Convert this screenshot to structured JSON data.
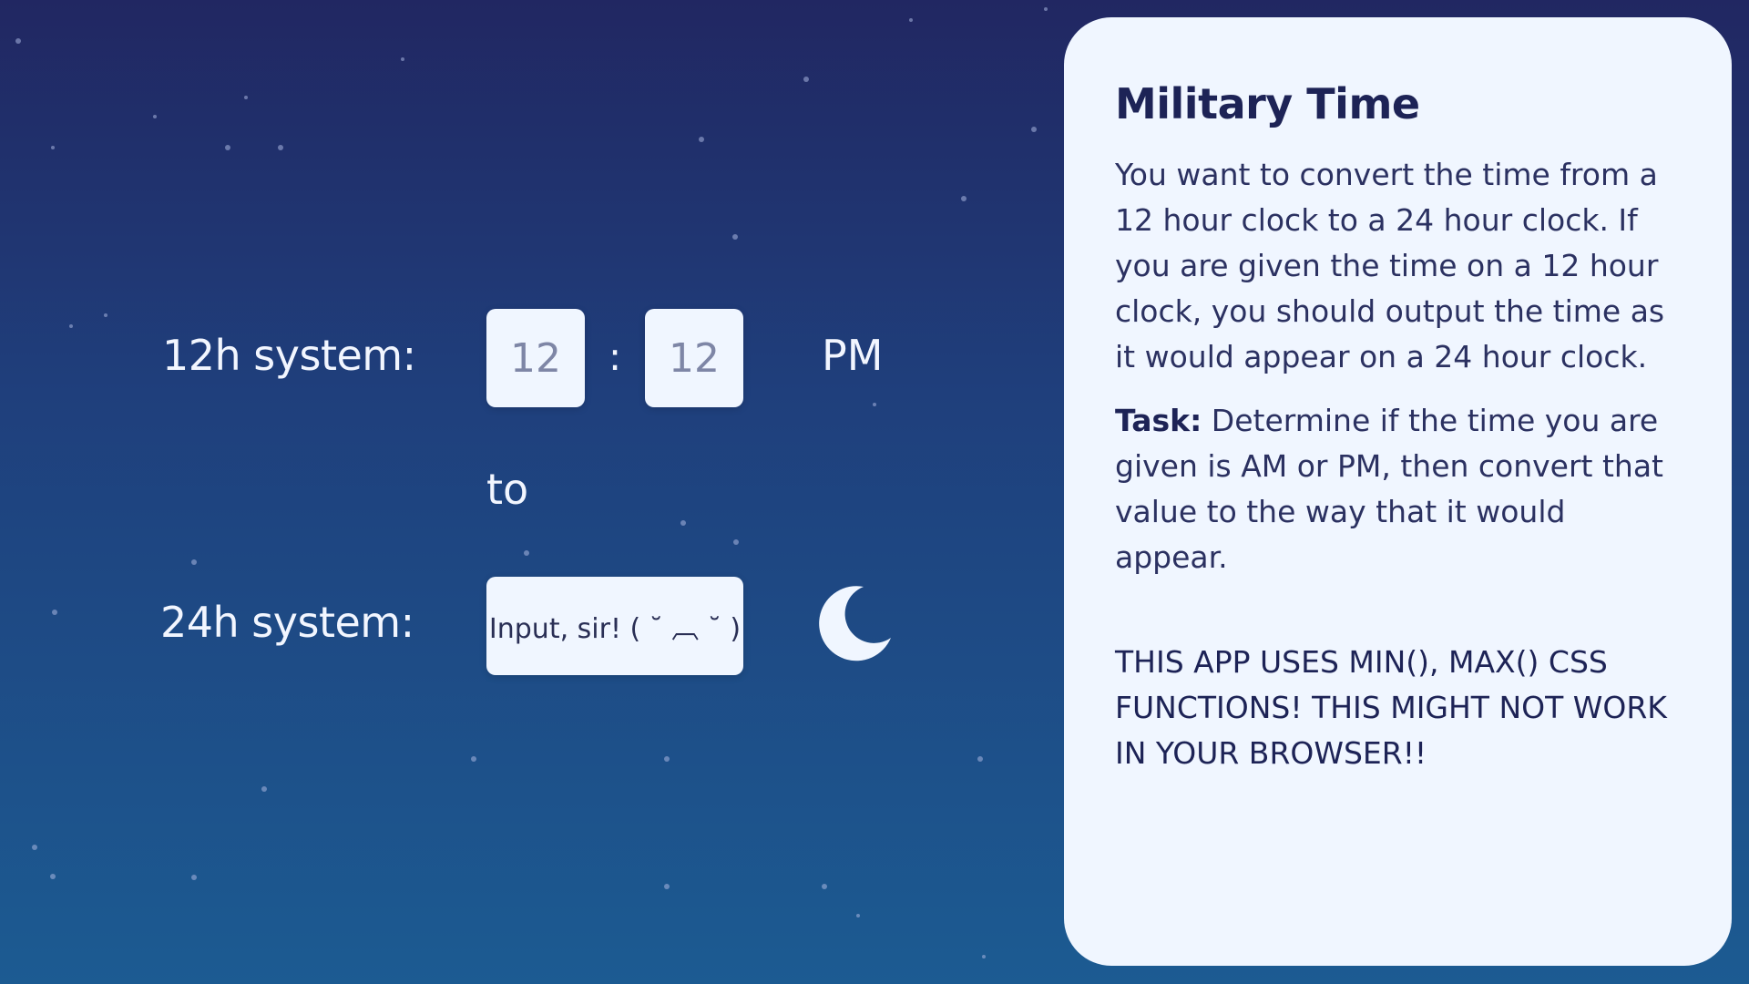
{
  "app": {
    "background_colors": [
      "#212762",
      "#1f3f7c",
      "#1c5b92"
    ],
    "accent_panel_color": "#f0f6ff"
  },
  "converter": {
    "row12_label": "12h system:",
    "hours_value": "12",
    "separator": ":",
    "minutes_value": "12",
    "period": "PM",
    "to_label": "to",
    "row24_label": "24h system:",
    "output_placeholder": "Input, sir! ( ˘ ︹ ˘ )",
    "theme_icon": "moon-icon"
  },
  "info": {
    "title": "Military Time",
    "description": "You want to convert the time from a 12 hour clock to a 24 hour clock. If you are given the time on a 12 hour clock, you should output the time as it would appear on a 24 hour clock.",
    "task_label": "Task:",
    "task_text": " Determine if the time you are given is AM or PM, then convert that value to the way that it would appear.",
    "warning": "THIS APP USES MIN(), MAX() CSS FUNCTIONS! THIS MIGHT NOT WORK IN YOUR BROWSER!!"
  }
}
